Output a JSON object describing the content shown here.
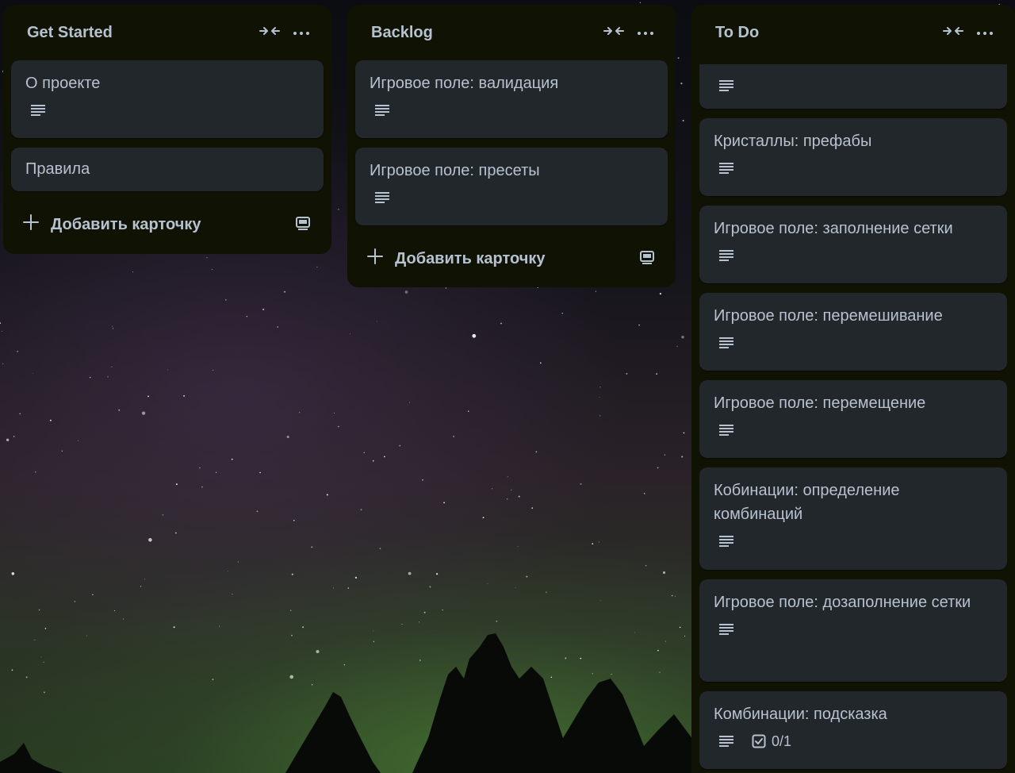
{
  "board": {
    "lists": [
      {
        "title": "Get Started",
        "cards": [
          {
            "title": "О проекте",
            "has_description": true
          },
          {
            "title": "Правила",
            "has_description": false
          }
        ],
        "add_card_label": "Добавить карточку"
      },
      {
        "title": "Backlog",
        "cards": [
          {
            "title": "Игровое поле: валидация",
            "has_description": true
          },
          {
            "title": "Игровое поле: пресеты",
            "has_description": true
          }
        ],
        "add_card_label": "Добавить карточку"
      },
      {
        "title": "To Do",
        "cards": [
          {
            "title": "",
            "has_description": true
          },
          {
            "title": "Кристаллы: префабы",
            "has_description": true
          },
          {
            "title": "Игровое поле: заполнение сетки",
            "has_description": true
          },
          {
            "title": "Игровое поле: перемешивание",
            "has_description": true
          },
          {
            "title": "Игровое поле: перемещение",
            "has_description": true
          },
          {
            "title": "Кобинации: определение комбинаций",
            "has_description": true
          },
          {
            "title": "Игровое поле: дозаполнение сетки",
            "has_description": true
          },
          {
            "title": "Комбинации: подсказка",
            "has_description": true,
            "checklist": "0/1"
          }
        ]
      }
    ]
  },
  "icons": {
    "collapse": "collapse-arrows-icon",
    "more": "more-dots-icon",
    "description": "description-lines-icon",
    "add": "plus-icon",
    "template": "card-template-icon",
    "checklist": "checkbox-icon"
  },
  "colors": {
    "list_bg": "#101204",
    "card_bg": "#22272b",
    "text": "#b6c2cf"
  }
}
